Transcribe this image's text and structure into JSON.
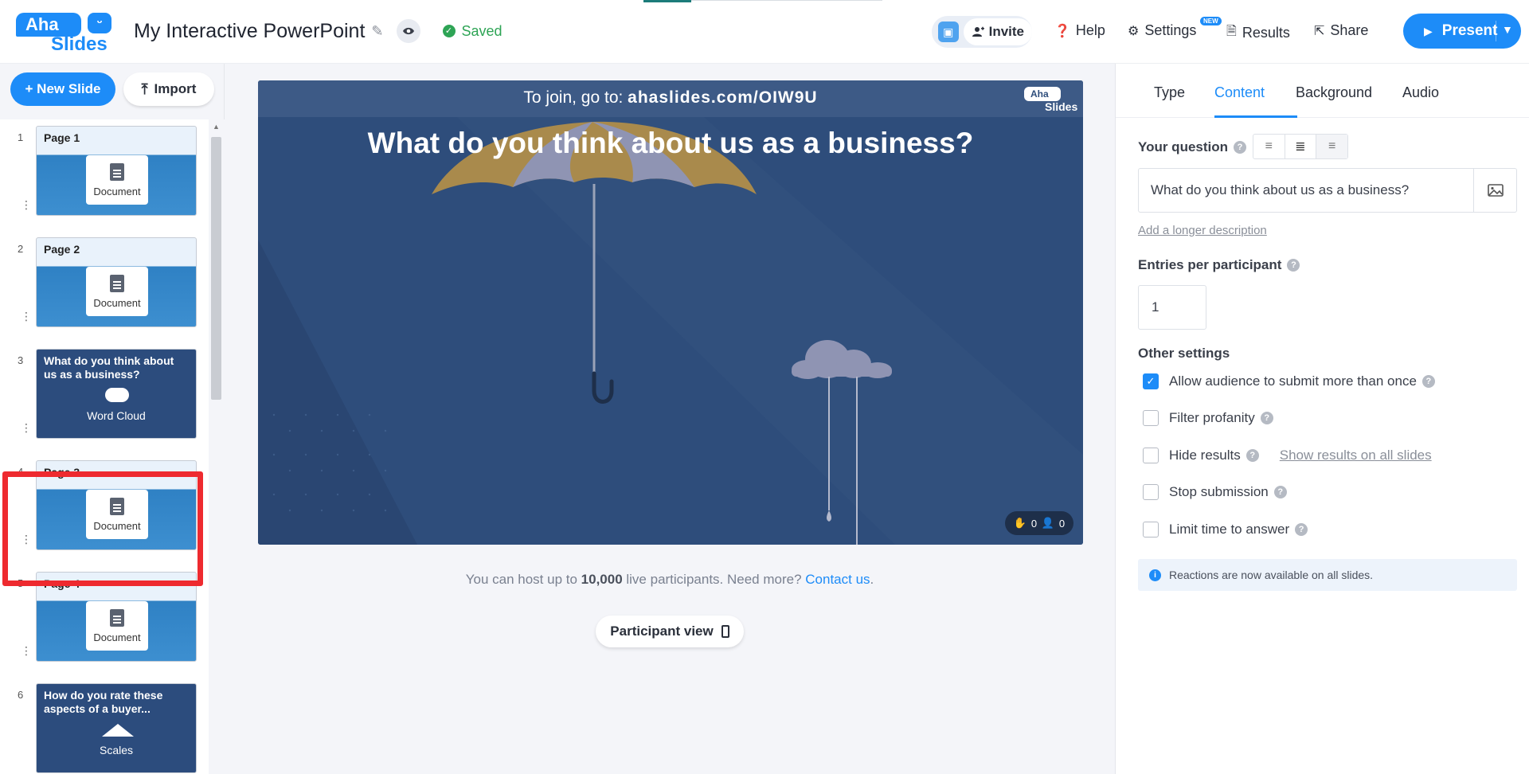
{
  "header": {
    "logo_top": "Aha",
    "logo_bottom": "Slides",
    "logo_smile": "ᵕ",
    "title": "My Interactive PowerPoint",
    "saved_label": "Saved",
    "invite_label": "Invite",
    "help_label": "Help",
    "settings_label": "Settings",
    "settings_badge": "NEW",
    "results_label": "Results",
    "share_label": "Share",
    "present_label": "Present"
  },
  "sidebar": {
    "new_slide_label": "+ New Slide",
    "import_label": "Import",
    "slides": [
      {
        "num": "1",
        "title": "Page 1",
        "type": "Document"
      },
      {
        "num": "2",
        "title": "Page 2",
        "type": "Document"
      },
      {
        "num": "3",
        "title": "What do you think about us as a business?",
        "type": "Word Cloud"
      },
      {
        "num": "4",
        "title": "Page 3",
        "type": "Document"
      },
      {
        "num": "5",
        "title": "Page 4",
        "type": "Document"
      },
      {
        "num": "6",
        "title": "How do you rate these aspects of a buyer...",
        "type": "Scales"
      }
    ]
  },
  "stage": {
    "join_prefix": "To join, go to: ",
    "join_url": "ahaslides.com/OIW9U",
    "question": "What do you think about us as a business?",
    "logo_top": "Aha",
    "logo_bottom": "Slides",
    "reactions_count": "0",
    "participants_count": "0"
  },
  "center": {
    "host_note_prefix": "You can host up to ",
    "host_note_number": "10,000",
    "host_note_suffix": " live participants. Need more? ",
    "contact_link": "Contact us",
    "host_note_end": ".",
    "participant_view_label": "Participant view"
  },
  "panel": {
    "tabs": [
      "Type",
      "Content",
      "Background",
      "Audio"
    ],
    "active_tab": "Content",
    "your_question_label": "Your question",
    "question_value": "What do you think about us as a business?",
    "longer_desc_link": "Add a longer description",
    "entries_label": "Entries per participant",
    "entries_value": "1",
    "other_settings_label": "Other settings",
    "settings": [
      {
        "label": "Allow audience to submit more than once",
        "checked": true
      },
      {
        "label": "Filter profanity",
        "checked": false
      },
      {
        "label": "Hide results",
        "checked": false
      },
      {
        "label": "Stop submission",
        "checked": false
      },
      {
        "label": "Limit time to answer",
        "checked": false
      }
    ],
    "show_results_link": "Show results on all slides",
    "info_text": "Reactions are now available on all slides."
  },
  "colors": {
    "brand_blue": "#1d8cf8",
    "stage_bg": "#2e4d7b",
    "saved_green": "#2ea455",
    "highlight_red": "#ee2a2f"
  }
}
